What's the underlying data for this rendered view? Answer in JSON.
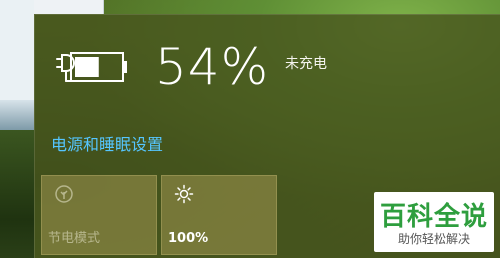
{
  "battery": {
    "percent_text": "54%",
    "status_text": "未充电",
    "charge_level": 0.54,
    "icon": "battery-icon"
  },
  "settings_link": {
    "label": "电源和睡眠设置"
  },
  "quick_actions": [
    {
      "label": "节电模式",
      "icon": "leaf-icon",
      "state": "disabled"
    },
    {
      "label": "100%",
      "icon": "sun-icon",
      "state": "active"
    }
  ],
  "watermark": {
    "title": "百科全说",
    "subtitle": "助你轻松解决"
  },
  "colors": {
    "link": "#55c6ff",
    "panel": "#46521c",
    "tile": "#a09650",
    "watermark_green": "#2e9e3e"
  }
}
